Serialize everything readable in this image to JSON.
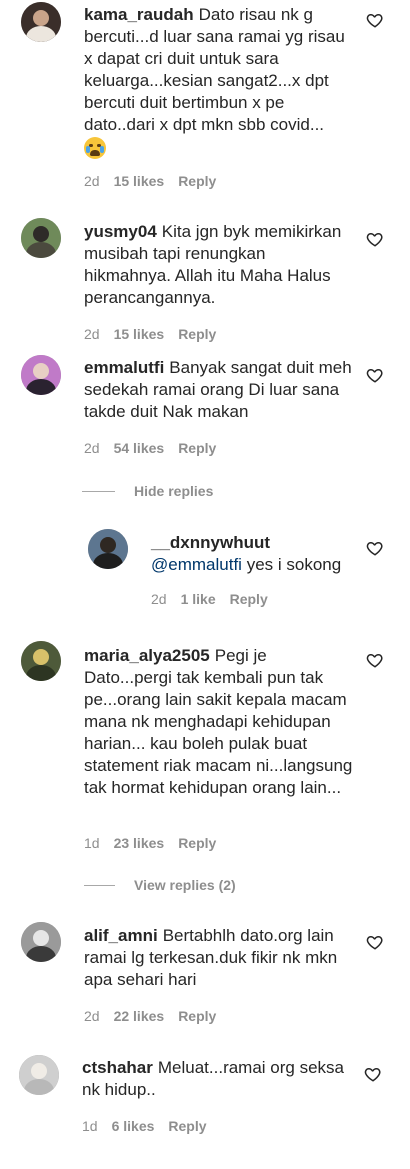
{
  "comments": [
    {
      "username": "kama_raudah",
      "text": "Dato risau nk g bercuti...d luar sana ramai yg risau x dapat cri duit untuk sara keluarga...kesian sangat2...x dpt bercuti duit bertimbun x pe dato..dari x dpt mkn sbb covid...",
      "emoji": "crying-face-emoji",
      "time": "2d",
      "likes": "15 likes",
      "reply": "Reply"
    },
    {
      "username": "yusmy04",
      "text": "Kita jgn byk memikirkan musibah tapi renungkan hikmahnya. Allah itu Maha Halus perancangannya.",
      "time": "2d",
      "likes": "15 likes",
      "reply": "Reply"
    },
    {
      "username": "emmalutfi",
      "text": "Banyak sangat duit meh sedekah ramai orang Di luar sana takde duit Nak makan",
      "time": "2d",
      "likes": "54 likes",
      "reply": "Reply",
      "replies_toggle": "Hide replies"
    },
    {
      "username": "__dxnnywhuut",
      "mention": "@emmalutfi",
      "text": "yes i sokong",
      "time": "2d",
      "likes": "1 like",
      "reply": "Reply"
    },
    {
      "username": "maria_alya2505",
      "text": "Pegi je Dato...pergi tak kembali pun tak pe...orang lain sakit kepala macam mana nk menghadapi kehidupan harian... kau boleh pulak buat statement riak macam ni...langsung tak hormat kehidupan orang lain...",
      "time": "1d",
      "likes": "23 likes",
      "reply": "Reply",
      "replies_toggle": "View replies (2)"
    },
    {
      "username": "alif_amni",
      "text": "Bertabhlh dato.org lain ramai lg terkesan.duk fikir nk mkn apa sehari hari",
      "time": "2d",
      "likes": "22 likes",
      "reply": "Reply"
    },
    {
      "username": "ctshahar",
      "text": "Meluat...ramai org seksa nk hidup..",
      "time": "1d",
      "likes": "6 likes",
      "reply": "Reply"
    }
  ],
  "icons": {
    "heart": "heart-outline-icon"
  },
  "colors": {
    "text": "#262626",
    "muted": "#8e8e8e",
    "mention": "#00376b",
    "divider": "#a8a8a8"
  }
}
